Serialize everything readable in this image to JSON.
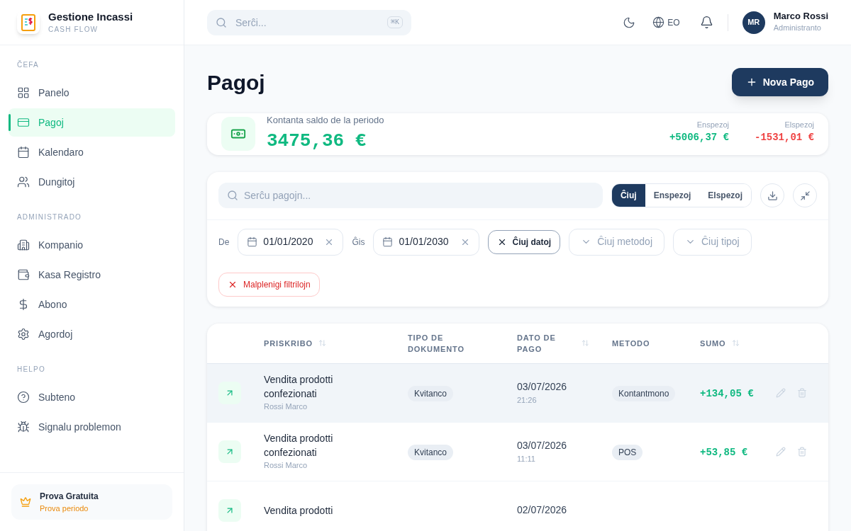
{
  "brand": {
    "name": "Gestione Incassi",
    "tagline": "CASH FLOW"
  },
  "sidebar": {
    "sections": [
      {
        "title": "ČEFA",
        "items": [
          {
            "label": "Panelo",
            "selected": false
          },
          {
            "label": "Pagoj",
            "selected": true
          },
          {
            "label": "Kalendaro",
            "selected": false
          },
          {
            "label": "Dungitoj",
            "selected": false
          }
        ]
      },
      {
        "title": "ADMINISTRADO",
        "items": [
          {
            "label": "Kompanio",
            "selected": false
          },
          {
            "label": "Kasa Registro",
            "selected": false
          },
          {
            "label": "Abono",
            "selected": false
          },
          {
            "label": "Agordoj",
            "selected": false
          }
        ]
      },
      {
        "title": "HELPO",
        "items": [
          {
            "label": "Subteno",
            "selected": false
          },
          {
            "label": "Signalu problemon",
            "selected": false
          }
        ]
      }
    ],
    "trial": {
      "title": "Prova Gratuita",
      "subtitle": "Prova periodo"
    }
  },
  "header": {
    "search": {
      "placeholder": "Serĉi...",
      "shortcut": "⌘K"
    },
    "language": "EO",
    "user": {
      "initials": "MR",
      "name": "Marco Rossi",
      "role": "Administranto"
    }
  },
  "page": {
    "title": "Pagoj",
    "new_button": "Nova Pago"
  },
  "summary": {
    "label": "Kontanta saldo de la periodo",
    "balance": "3475,36 €",
    "stats": [
      {
        "label": "Enspezoj",
        "value": "+5006,37 €",
        "kind": "income"
      },
      {
        "label": "Elspezoj",
        "value": "-1531,01 €",
        "kind": "expense"
      }
    ]
  },
  "filters": {
    "search": {
      "placeholder": "Serĉu pagojn..."
    },
    "segments": [
      {
        "label": "Ĉiuj",
        "selected": true
      },
      {
        "label": "Enspezoj",
        "selected": false
      },
      {
        "label": "Elspezoj",
        "selected": false
      }
    ],
    "from": {
      "label": "De",
      "value": "01/01/2020"
    },
    "to": {
      "label": "Ĝis",
      "value": "01/01/2030"
    },
    "all_dates": "Ĉiuj datoj",
    "method_placeholder": "Ĉiuj metodoj",
    "type_placeholder": "Ĉiuj tipoj",
    "clear": "Malplenigi filtrilojn"
  },
  "table": {
    "columns": [
      {
        "label": "PRISKRIBO",
        "sortable": true
      },
      {
        "label": "TIPO DE DOKUMENTO",
        "sortable": false
      },
      {
        "label": "DATO DE PAGO",
        "sortable": true
      },
      {
        "label": "METODO",
        "sortable": false
      },
      {
        "label": "SUMO",
        "sortable": true
      }
    ],
    "rows": [
      {
        "description": "Vendita prodotti confezionati",
        "person": "Rossi Marco",
        "type": "Kvitanco",
        "date": "03/07/2026",
        "time": "21:26",
        "method": "Kontantmono",
        "amount": "+134,05 €",
        "selected": true
      },
      {
        "description": "Vendita prodotti confezionati",
        "person": "Rossi Marco",
        "type": "Kvitanco",
        "date": "03/07/2026",
        "time": "11:11",
        "method": "POS",
        "amount": "+53,85 €",
        "selected": false
      },
      {
        "description": "Vendita prodotti",
        "date": "02/07/2026",
        "selected": false
      }
    ]
  }
}
